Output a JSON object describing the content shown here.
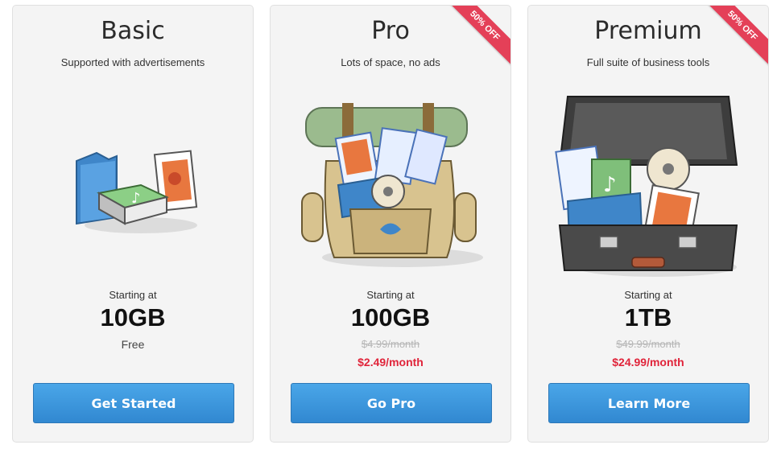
{
  "plans": [
    {
      "name": "Basic",
      "description": "Supported with advertisements",
      "starting_label": "Starting at",
      "storage": "10GB",
      "price": "Free",
      "button": "Get Started"
    },
    {
      "name": "Pro",
      "description": "Lots of space, no ads",
      "starting_label": "Starting at",
      "storage": "100GB",
      "old_price": "$4.99/month",
      "new_price": "$2.49/month",
      "button": "Go Pro",
      "ribbon": "50% OFF"
    },
    {
      "name": "Premium",
      "description": "Full suite of business tools",
      "starting_label": "Starting at",
      "storage": "1TB",
      "old_price": "$49.99/month",
      "new_price": "$24.99/month",
      "button": "Learn More",
      "ribbon": "50% OFF"
    }
  ],
  "colors": {
    "button": "#3b95dd",
    "sale_price": "#e0243a",
    "ribbon": "#e44058"
  },
  "icons": [
    "folder-music-photos-icon",
    "backpack-icon",
    "briefcase-icon"
  ]
}
